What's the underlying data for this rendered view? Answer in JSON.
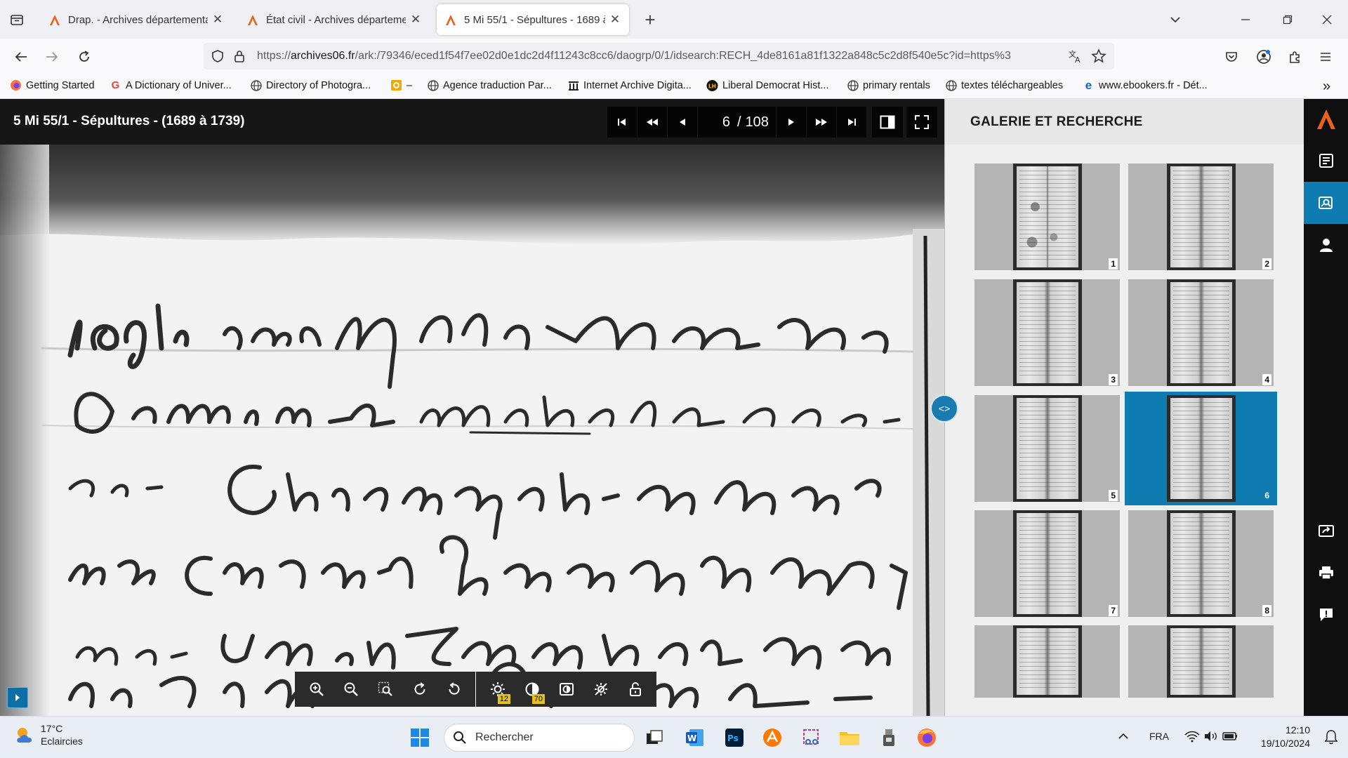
{
  "browser": {
    "tabs": [
      {
        "title": "Drap. - Archives départementales",
        "active": false
      },
      {
        "title": "État civil - Archives départementales",
        "active": false
      },
      {
        "title": "5 Mi 55/1 - Sépultures - 1689 à",
        "active": true
      }
    ],
    "url": {
      "prefix": "https://",
      "domain": "archives06.fr",
      "path": "/ark:/79346/eced1f54f7ee02d0e1dc2d4f11243c8cc6/daogrp/0/1/idsearch:RECH_4de8161a81f1322a848c5c2d8f540e5c?id=https%3"
    },
    "bookmarks": [
      {
        "label": "Getting Started",
        "icon": "firefox-icon"
      },
      {
        "label": "A Dictionary of Univer...",
        "icon": "google-icon"
      },
      {
        "label": "Directory of Photogra...",
        "icon": "globe-icon"
      },
      {
        "label": "–",
        "icon": "orange-square-icon"
      },
      {
        "label": "Agence traduction Par...",
        "icon": "globe-icon"
      },
      {
        "label": "Internet Archive Digita...",
        "icon": "archive-icon"
      },
      {
        "label": "Liberal Democrat Hist...",
        "icon": "lh-icon"
      },
      {
        "label": "primary rentals",
        "icon": "globe-icon"
      },
      {
        "label": "textes téléchargeables",
        "icon": "globe-icon"
      },
      {
        "label": "www.ebookers.fr - Dét...",
        "icon": "ebookers-icon"
      }
    ]
  },
  "viewer": {
    "title": "5 Mi 55/1 - Sépultures - (1689 à 1739)",
    "current_page": "6",
    "separator": "/",
    "total_pages": "108",
    "brightness_value": "12",
    "contrast_value": "70"
  },
  "gallery": {
    "title": "GALERIE ET RECHERCHE",
    "thumbnails": [
      {
        "num": "1",
        "selected": false
      },
      {
        "num": "2",
        "selected": false
      },
      {
        "num": "3",
        "selected": false
      },
      {
        "num": "4",
        "selected": false
      },
      {
        "num": "5",
        "selected": false
      },
      {
        "num": "6",
        "selected": true
      },
      {
        "num": "7",
        "selected": false
      },
      {
        "num": "8",
        "selected": false
      },
      {
        "num": "",
        "selected": false
      },
      {
        "num": "",
        "selected": false
      }
    ],
    "divider_label": "<>"
  },
  "taskbar": {
    "weather_temp": "17°C",
    "weather_desc": "Eclaircies",
    "search_placeholder": "Rechercher",
    "language": "FRA",
    "time": "12:10",
    "date": "19/10/2024"
  },
  "colors": {
    "accent_blue": "#0e7bb1",
    "archive_orange": "#e8631c",
    "viewer_header": "#161616"
  }
}
